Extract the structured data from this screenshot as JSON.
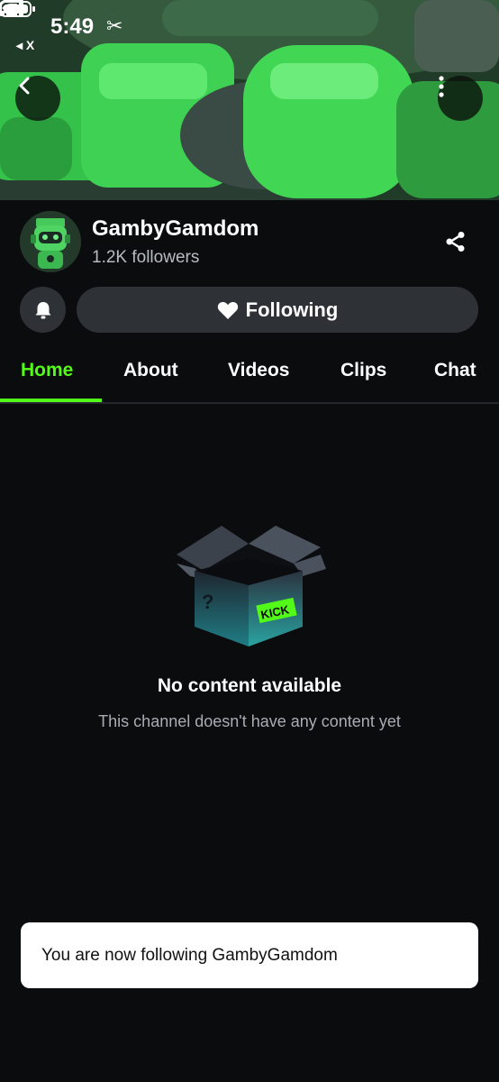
{
  "status_bar": {
    "time": "5:49",
    "back_app": "◂ X"
  },
  "channel": {
    "name": "GambyGamdom",
    "followers": "1.2K followers"
  },
  "actions": {
    "follow_label": "Following"
  },
  "tabs": [
    {
      "label": "Home",
      "active": true
    },
    {
      "label": "About",
      "active": false
    },
    {
      "label": "Videos",
      "active": false
    },
    {
      "label": "Clips",
      "active": false
    },
    {
      "label": "Chat",
      "active": false
    }
  ],
  "empty_state": {
    "title": "No content available",
    "subtitle": "This channel doesn't have any content yet",
    "box_label": "KICK"
  },
  "toast": {
    "message": "You are now following GambyGamdom"
  },
  "colors": {
    "accent": "#53fc18",
    "background": "#0b0c0e",
    "button": "#2e3136"
  },
  "icons": [
    "back-arrow-icon",
    "more-vertical-icon",
    "share-icon",
    "bell-icon",
    "heart-icon",
    "signal-icon",
    "wifi-icon",
    "battery-icon",
    "scissors-icon"
  ]
}
